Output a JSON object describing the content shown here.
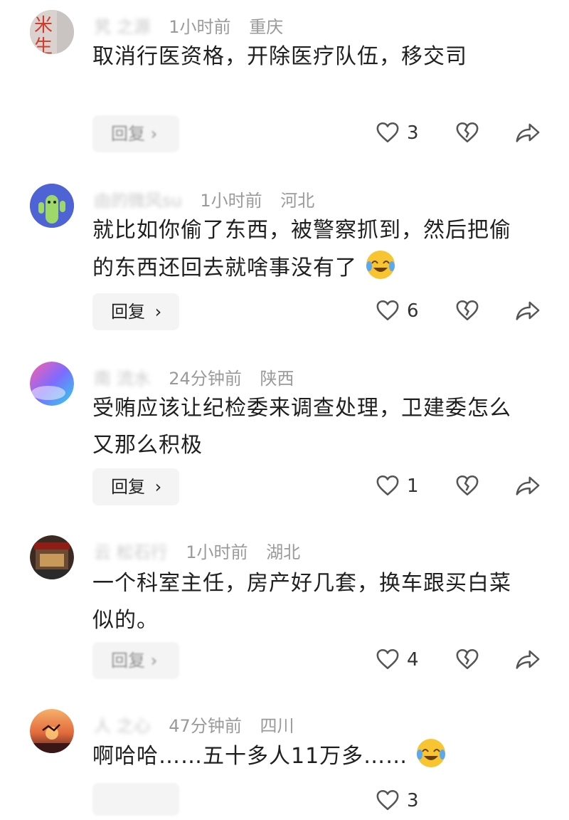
{
  "comments": [
    {
      "user": "旯 之源",
      "time": "1小时前",
      "location": "重庆",
      "text": "取消行医资格，开除医疗队伍，移交司",
      "reply_label": "回复 ›",
      "likes": "3",
      "avatar_char": "米生"
    },
    {
      "user": "由的微风su",
      "time": "1小时前",
      "location": "河北",
      "text": "就比如你偷了东西，被警察抓到，然后把偷的东西还回去就啥事没有了",
      "reply_label": "回复",
      "likes": "6"
    },
    {
      "user": "南 流水",
      "time": "24分钟前",
      "location": "陕西",
      "text": "受贿应该让纪检委来调查处理，卫建委怎么又那么积极",
      "reply_label": "回复",
      "likes": "1"
    },
    {
      "user": "云 松石行",
      "time": "1小时前",
      "location": "湖北",
      "text": "一个科室主任，房产好几套，换车跟买白菜似的。",
      "reply_label": "回复 ›",
      "likes": "4"
    },
    {
      "user": "人 之心",
      "time": "47分钟前",
      "location": "四川",
      "text": "啊哈哈……五十多人11万多……",
      "reply_label": "",
      "likes": "3"
    }
  ],
  "colors": {
    "meta": "#9a9a9a",
    "text": "#1f1f1f",
    "reply_bg": "#f4f4f4",
    "icon": "#555555"
  },
  "icons": [
    "heart-icon",
    "broken-heart-icon",
    "share-icon",
    "laughing-crying-emoji"
  ]
}
